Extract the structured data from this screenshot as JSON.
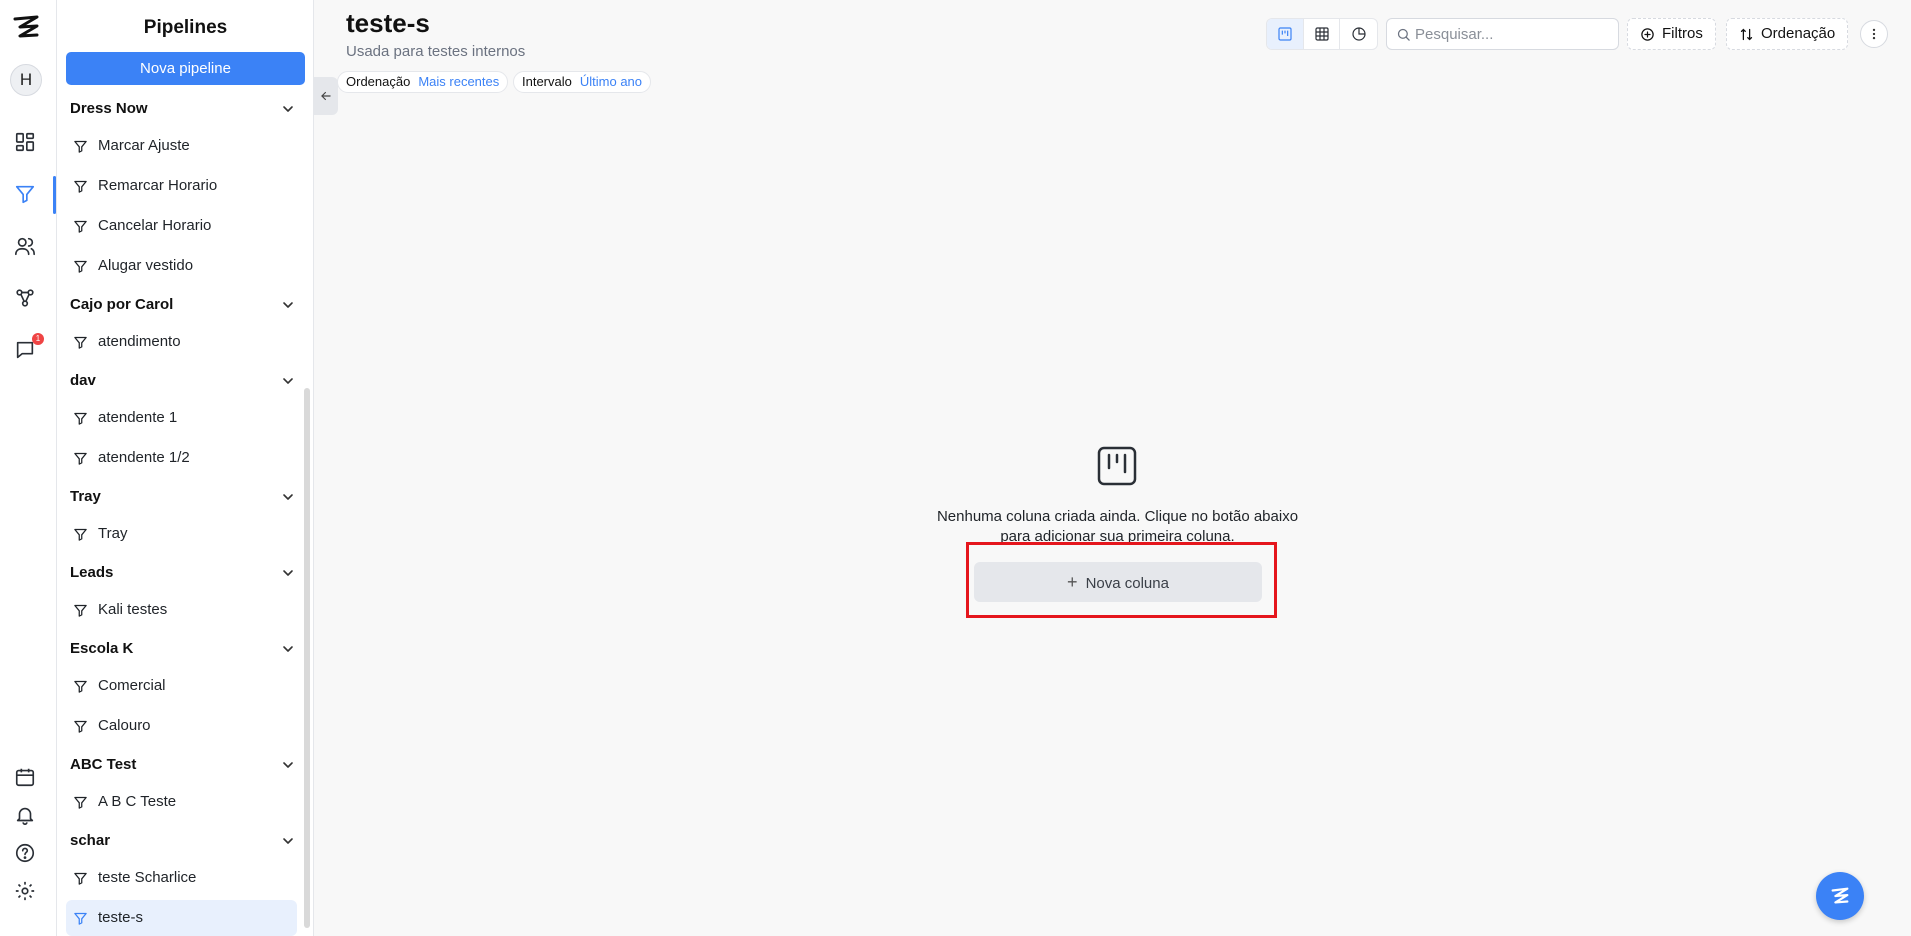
{
  "app": {
    "avatar_initial": "H",
    "notification_count": "1"
  },
  "sidebar": {
    "title": "Pipelines",
    "new_button": "Nova pipeline",
    "groups": [
      {
        "name": "Dress Now",
        "items": [
          "Marcar Ajuste",
          "Remarcar Horario",
          "Cancelar Horario",
          "Alugar vestido"
        ]
      },
      {
        "name": "Cajo por Carol",
        "items": [
          "atendimento"
        ]
      },
      {
        "name": "dav",
        "items": [
          "atendente 1",
          "atendente 1/2"
        ]
      },
      {
        "name": "Tray",
        "items": [
          "Tray"
        ]
      },
      {
        "name": "Leads",
        "items": [
          "Kali testes"
        ]
      },
      {
        "name": "Escola K",
        "items": [
          "Comercial",
          "Calouro"
        ]
      },
      {
        "name": "ABC Test",
        "items": [
          "A B C Teste"
        ]
      },
      {
        "name": "schar",
        "items": [
          "teste Scharlice",
          "teste-s"
        ]
      }
    ],
    "selected_item": "teste-s"
  },
  "header": {
    "title": "teste-s",
    "subtitle": "Usada para testes internos",
    "chips": [
      {
        "label": "Ordenação",
        "value": "Mais recentes"
      },
      {
        "label": "Intervalo",
        "value": "Último ano"
      }
    ],
    "search_placeholder": "Pesquisar...",
    "filters_label": "Filtros",
    "sort_label": "Ordenação"
  },
  "empty_state": {
    "message": "Nenhuma coluna criada ainda. Clique no botão abaixo para adicionar sua primeira coluna.",
    "button_label": "Nova coluna"
  },
  "colors": {
    "accent": "#3b82f6",
    "highlight": "#e5161d"
  }
}
